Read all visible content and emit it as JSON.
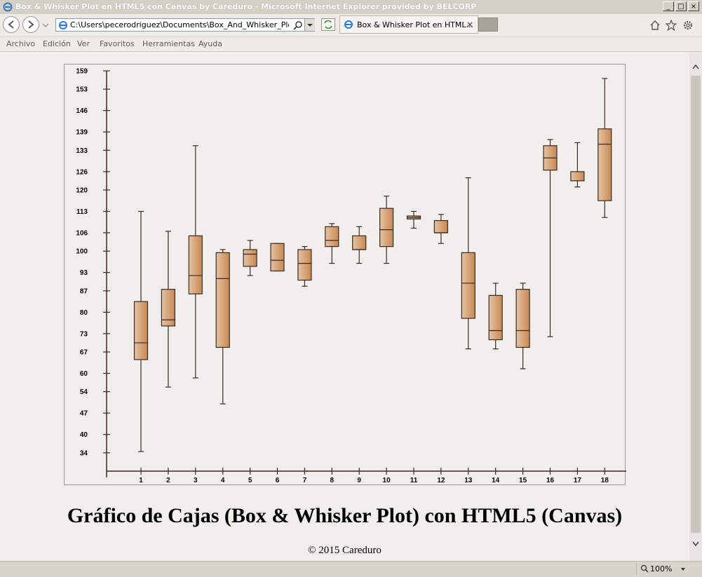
{
  "window": {
    "title": "Box & Whisker Plot en HTML5 con Canvas by Careduro - Microsoft Internet Explorer provided by BELCORP"
  },
  "browser": {
    "address": "C:\\Users\\pecerodriguez\\Documents\\Box_And_Whisker_Plot_By_C",
    "tab_title": "Box & Whisker Plot en HTML...",
    "menu": [
      "Archivo",
      "Edición",
      "Ver",
      "Favoritos",
      "Herramientas",
      "Ayuda"
    ],
    "zoom": "100%"
  },
  "page": {
    "heading": "Gráfico de Cajas (Box & Whisker Plot) con HTML5 (Canvas)",
    "footer": "© 2015 Careduro"
  },
  "colors": {
    "box_light": "#e4c3a6",
    "box_dark": "#c98850",
    "axis": "#3a2a24",
    "frame": "#9c9a96"
  },
  "chart_data": {
    "type": "box",
    "title": "",
    "xlabel": "",
    "ylabel": "",
    "ylim": [
      28,
      159
    ],
    "y_ticks": [
      34,
      40,
      47,
      54,
      60,
      67,
      73,
      80,
      87,
      93,
      100,
      106,
      113,
      120,
      126,
      133,
      139,
      146,
      153,
      159
    ],
    "categories": [
      "1",
      "2",
      "3",
      "4",
      "5",
      "6",
      "7",
      "8",
      "9",
      "10",
      "11",
      "12",
      "13",
      "14",
      "15",
      "16",
      "17",
      "18"
    ],
    "boxes": [
      {
        "min": 34.4,
        "q1": 64.5,
        "median": 70.0,
        "q3": 83.5,
        "max": 113.0
      },
      {
        "min": 55.5,
        "q1": 75.5,
        "median": 77.5,
        "q3": 87.5,
        "max": 106.5
      },
      {
        "min": 58.5,
        "q1": 86.0,
        "median": 92.0,
        "q3": 105.0,
        "max": 134.5
      },
      {
        "min": 50.0,
        "q1": 68.5,
        "median": 91.0,
        "q3": 99.5,
        "max": 100.5
      },
      {
        "min": 92.0,
        "q1": 95.0,
        "median": 99.0,
        "q3": 100.5,
        "max": 103.5
      },
      {
        "min": 93.5,
        "q1": 93.5,
        "median": 97.0,
        "q3": 102.5,
        "max": 102.5
      },
      {
        "min": 88.5,
        "q1": 90.5,
        "median": 96.0,
        "q3": 100.5,
        "max": 101.5
      },
      {
        "min": 96.0,
        "q1": 101.5,
        "median": 103.5,
        "q3": 108.0,
        "max": 109.0
      },
      {
        "min": 96.0,
        "q1": 100.5,
        "median": 100.5,
        "q3": 105.0,
        "max": 108.0
      },
      {
        "min": 96.0,
        "q1": 101.5,
        "median": 107.0,
        "q3": 114.0,
        "max": 118.0
      },
      {
        "min": 107.5,
        "q1": 110.5,
        "median": 111.0,
        "q3": 111.5,
        "max": 113.0
      },
      {
        "min": 102.5,
        "q1": 106.0,
        "median": 106.0,
        "q3": 110.0,
        "max": 112.0
      },
      {
        "min": 68.0,
        "q1": 78.0,
        "median": 89.5,
        "q3": 99.5,
        "max": 124.0
      },
      {
        "min": 68.0,
        "q1": 71.0,
        "median": 74.0,
        "q3": 85.5,
        "max": 89.5
      },
      {
        "min": 61.5,
        "q1": 68.5,
        "median": 74.0,
        "q3": 87.5,
        "max": 89.5
      },
      {
        "min": 72.0,
        "q1": 126.5,
        "median": 130.5,
        "q3": 134.5,
        "max": 136.5
      },
      {
        "min": 121.0,
        "q1": 123.0,
        "median": 123.0,
        "q3": 126.0,
        "max": 135.5
      },
      {
        "min": 111.0,
        "q1": 116.5,
        "median": 135.0,
        "q3": 140.0,
        "max": 156.5
      }
    ]
  }
}
